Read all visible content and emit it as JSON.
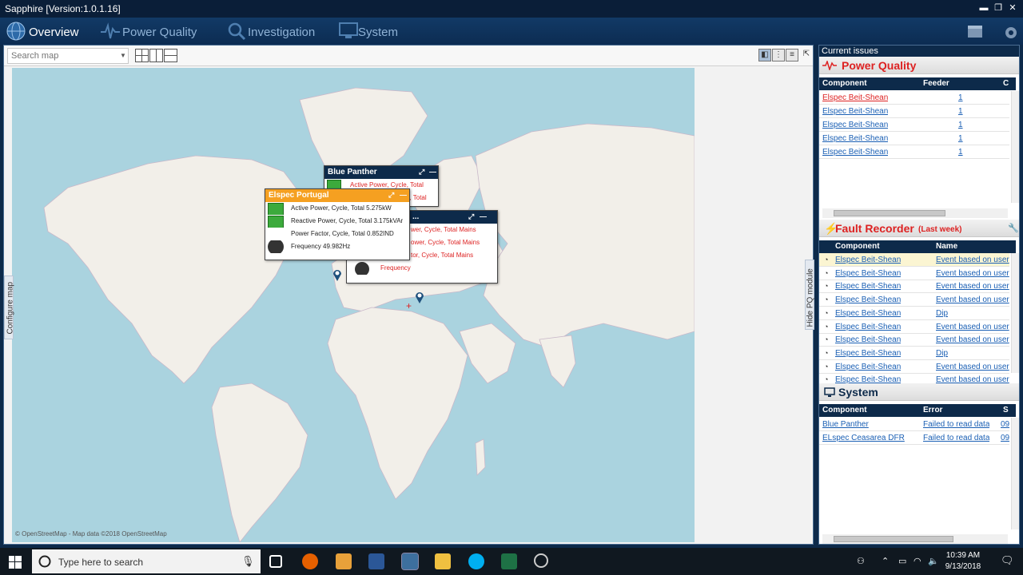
{
  "window": {
    "title": "Sapphire [Version:1.0.1.16]"
  },
  "nav": {
    "tabs": [
      {
        "label": "Overview",
        "icon": "globe-icon"
      },
      {
        "label": "Power Quality",
        "icon": "waveform-icon"
      },
      {
        "label": "Investigation",
        "icon": "magnifier-icon"
      },
      {
        "label": "System",
        "icon": "monitor-icon"
      }
    ],
    "active": "Overview"
  },
  "map": {
    "search_placeholder": "Search map",
    "configure_label": "Configure map",
    "hide_label": "Hide PQ module",
    "attribution": "© OpenStreetMap - Map data ©2018 OpenStreetMap"
  },
  "popups": {
    "blue_panther": {
      "title": "Blue Panther",
      "rows": [
        "Active Power, Cycle, Total",
        "e, Total"
      ]
    },
    "mid": {
      "title": "...",
      "rows": [
        "wer, Cycle, Total Mains",
        "ower, Cycle, Total Mains",
        "tor, Cycle, Total Mains",
        "Frequency"
      ]
    },
    "elspec_portugal": {
      "title": "Elspec Portugal",
      "rows": [
        "Active Power, Cycle, Total 5.275kW",
        "Reactive Power, Cycle, Total 3.175kVAr",
        "Power Factor, Cycle, Total 0.852IND",
        "Frequency 49.982Hz"
      ]
    }
  },
  "issues": {
    "header": "Current issues",
    "power_quality": {
      "title": "Power Quality",
      "columns": [
        "Component",
        "Feeder",
        "C"
      ],
      "rows": [
        {
          "component": "Elspec Beit-Shean",
          "feeder": "1"
        },
        {
          "component": "Elspec Beit-Shean",
          "feeder": "1"
        },
        {
          "component": "Elspec Beit-Shean",
          "feeder": "1"
        },
        {
          "component": "Elspec Beit-Shean",
          "feeder": "1"
        },
        {
          "component": "Elspec Beit-Shean",
          "feeder": "1"
        }
      ]
    },
    "fault_recorder": {
      "title": "Fault Recorder",
      "subtitle": "(Last week)",
      "columns": [
        "Component",
        "Name"
      ],
      "rows": [
        {
          "component": "Elspec Beit-Shean",
          "name": "Event based on user"
        },
        {
          "component": "Elspec Beit-Shean",
          "name": "Event based on user"
        },
        {
          "component": "Elspec Beit-Shean",
          "name": "Event based on user"
        },
        {
          "component": "Elspec Beit-Shean",
          "name": "Event based on user"
        },
        {
          "component": "Elspec Beit-Shean",
          "name": "Dip"
        },
        {
          "component": "Elspec Beit-Shean",
          "name": "Event based on user"
        },
        {
          "component": "Elspec Beit-Shean",
          "name": "Event based on user"
        },
        {
          "component": "Elspec Beit-Shean",
          "name": "Dip"
        },
        {
          "component": "Elspec Beit-Shean",
          "name": "Event based on user"
        },
        {
          "component": "Elspec Beit-Shean",
          "name": "Event based on user"
        }
      ]
    },
    "system": {
      "title": "System",
      "columns": [
        "Component",
        "Error",
        "S"
      ],
      "rows": [
        {
          "component": "Blue Panther",
          "error": "Failed to read data",
          "s": "09"
        },
        {
          "component": "ELspec Ceasarea DFR",
          "error": "Failed to read data",
          "s": "09"
        }
      ]
    }
  },
  "taskbar": {
    "search_placeholder": "Type here to search",
    "time": "10:39 AM",
    "date": "9/13/2018"
  },
  "colors": {
    "accent": "#0d2a4a",
    "popup_orange": "#f5a021",
    "alert_red": "#dd2222",
    "link_blue": "#1a5fb4"
  }
}
